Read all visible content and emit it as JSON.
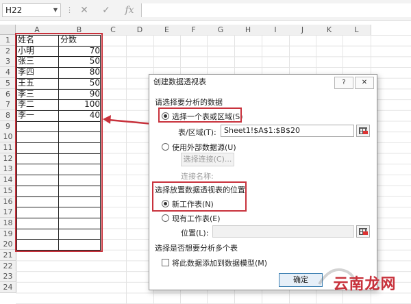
{
  "formula_bar": {
    "name_box": "H22",
    "icons": [
      "more-options-icon",
      "cancel-icon",
      "enter-check-icon",
      "insert-function-icon"
    ],
    "icon_glyphs": [
      "✕",
      "✓",
      "fx"
    ],
    "formula": ""
  },
  "sheet": {
    "columns": [
      "A",
      "B",
      "C",
      "D",
      "E",
      "F",
      "G",
      "H",
      "I",
      "J",
      "K",
      "L"
    ],
    "rows": [
      "1",
      "2",
      "3",
      "4",
      "5",
      "6",
      "7",
      "8",
      "9",
      "10",
      "11",
      "12",
      "13",
      "14",
      "15",
      "16",
      "17",
      "18",
      "19",
      "20",
      "21",
      "22",
      "23",
      "24"
    ],
    "headers": {
      "name": "姓名",
      "score": "分数"
    },
    "data": [
      {
        "name": "小明",
        "score": "70"
      },
      {
        "name": "张三",
        "score": "50"
      },
      {
        "name": "李四",
        "score": "80"
      },
      {
        "name": "王五",
        "score": "50"
      },
      {
        "name": "李三",
        "score": "90"
      },
      {
        "name": "李二",
        "score": "100"
      },
      {
        "name": "李一",
        "score": "40"
      }
    ]
  },
  "dialog": {
    "title": "创建数据透视表",
    "help_button": "?",
    "close_button": "✕",
    "section1": "请选择要分析的数据",
    "option_select_range": "选择一个表或区域(S)",
    "table_range_label": "表/区域(T):",
    "table_range_value": "Sheet1!$A$1:$B$20",
    "option_external": "使用外部数据源(U)",
    "choose_connection": "选择连接(C)...",
    "connection_name": "连接名称:",
    "section2": "选择放置数据透视表的位置",
    "option_new_sheet": "新工作表(N)",
    "option_existing_sheet": "现有工作表(E)",
    "location_label": "位置(L):",
    "location_value": "",
    "section3": "选择是否想要分析多个表",
    "add_to_model": "将此数据添加到数据模型(M)",
    "ok_button": "确定"
  },
  "colors": {
    "highlight": "#c8323c",
    "dialog_border": "#8e8e8e",
    "default_button": "#3c7fb1"
  },
  "watermark": {
    "text": "云南龙网"
  }
}
